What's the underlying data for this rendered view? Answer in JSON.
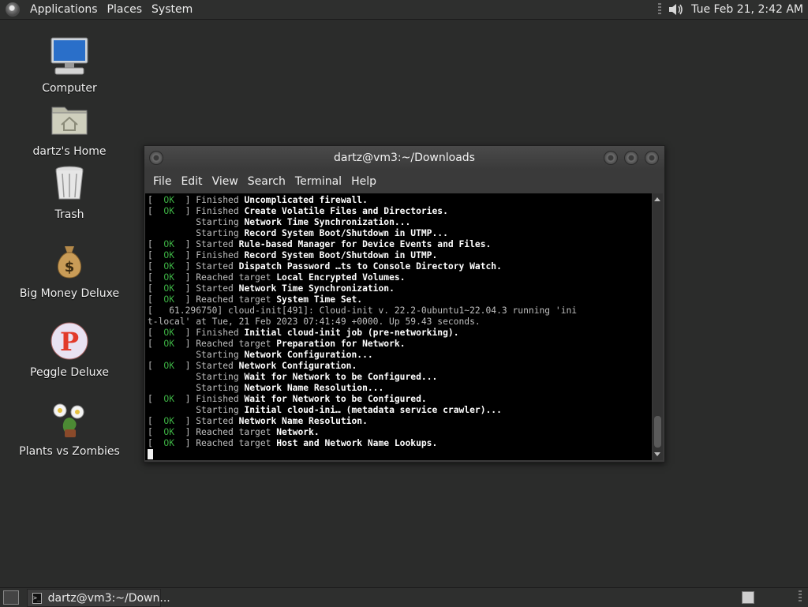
{
  "top_panel": {
    "menus": [
      "Applications",
      "Places",
      "System"
    ],
    "clock": "Tue Feb 21,  2:42 AM"
  },
  "desktop": {
    "icons": [
      {
        "label": "Computer",
        "icon": "computer-icon"
      },
      {
        "label": "dartz's Home",
        "icon": "home-folder-icon"
      },
      {
        "label": "Trash",
        "icon": "trash-icon"
      },
      {
        "label": "Big Money Deluxe",
        "icon": "money-bag-icon"
      },
      {
        "label": "Peggle Deluxe",
        "icon": "peggle-icon"
      },
      {
        "label": "Plants vs Zombies",
        "icon": "plants-vs-zombies-icon"
      }
    ]
  },
  "terminal": {
    "title": "dartz@vm3:~/Downloads",
    "menus": [
      "File",
      "Edit",
      "View",
      "Search",
      "Terminal",
      "Help"
    ],
    "lines": [
      {
        "prefix": "[  ",
        "ok": "OK",
        "suffix": "  ] Finished ",
        "bold": "Uncomplicated firewall",
        "tail": "."
      },
      {
        "prefix": "[  ",
        "ok": "OK",
        "suffix": "  ] Finished ",
        "bold": "Create Volatile Files and Directories",
        "tail": "."
      },
      {
        "prefix": "",
        "ok": "",
        "suffix": "         Starting ",
        "bold": "Network Time Synchronization",
        "tail": "..."
      },
      {
        "prefix": "",
        "ok": "",
        "suffix": "         Starting ",
        "bold": "Record System Boot/Shutdown in UTMP",
        "tail": "..."
      },
      {
        "prefix": "[  ",
        "ok": "OK",
        "suffix": "  ] Started ",
        "bold": "Rule-based Manager for Device Events and Files",
        "tail": "."
      },
      {
        "prefix": "[  ",
        "ok": "OK",
        "suffix": "  ] Finished ",
        "bold": "Record System Boot/Shutdown in UTMP",
        "tail": "."
      },
      {
        "prefix": "[  ",
        "ok": "OK",
        "suffix": "  ] Started ",
        "bold": "Dispatch Password …ts to Console Directory Watch",
        "tail": "."
      },
      {
        "prefix": "[  ",
        "ok": "OK",
        "suffix": "  ] Reached target ",
        "bold": "Local Encrypted Volumes",
        "tail": "."
      },
      {
        "prefix": "[  ",
        "ok": "OK",
        "suffix": "  ] Started ",
        "bold": "Network Time Synchronization",
        "tail": "."
      },
      {
        "prefix": "[  ",
        "ok": "OK",
        "suffix": "  ] Reached target ",
        "bold": "System Time Set",
        "tail": "."
      },
      {
        "prefix": "[   61.296750] cloud-init[491]: Cloud-init v. 22.2-0ubuntu1~22.04.3 running 'ini",
        "ok": "",
        "suffix": "",
        "bold": "",
        "tail": ""
      },
      {
        "prefix": "t-local' at Tue, 21 Feb 2023 07:41:49 +0000. Up 59.43 seconds.",
        "ok": "",
        "suffix": "",
        "bold": "",
        "tail": ""
      },
      {
        "prefix": "[  ",
        "ok": "OK",
        "suffix": "  ] Finished ",
        "bold": "Initial cloud-init job (pre-networking)",
        "tail": "."
      },
      {
        "prefix": "[  ",
        "ok": "OK",
        "suffix": "  ] Reached target ",
        "bold": "Preparation for Network",
        "tail": "."
      },
      {
        "prefix": "",
        "ok": "",
        "suffix": "         Starting ",
        "bold": "Network Configuration",
        "tail": "..."
      },
      {
        "prefix": "[  ",
        "ok": "OK",
        "suffix": "  ] Started ",
        "bold": "Network Configuration",
        "tail": "."
      },
      {
        "prefix": "",
        "ok": "",
        "suffix": "         Starting ",
        "bold": "Wait for Network to be Configured",
        "tail": "..."
      },
      {
        "prefix": "",
        "ok": "",
        "suffix": "         Starting ",
        "bold": "Network Name Resolution",
        "tail": "..."
      },
      {
        "prefix": "[  ",
        "ok": "OK",
        "suffix": "  ] Finished ",
        "bold": "Wait for Network to be Configured",
        "tail": "."
      },
      {
        "prefix": "",
        "ok": "",
        "suffix": "         Starting ",
        "bold": "Initial cloud-ini… (metadata service crawler)",
        "tail": "..."
      },
      {
        "prefix": "[  ",
        "ok": "OK",
        "suffix": "  ] Started ",
        "bold": "Network Name Resolution",
        "tail": "."
      },
      {
        "prefix": "[  ",
        "ok": "OK",
        "suffix": "  ] Reached target ",
        "bold": "Network",
        "tail": "."
      },
      {
        "prefix": "[  ",
        "ok": "OK",
        "suffix": "  ] Reached target ",
        "bold": "Host and Network Name Lookups",
        "tail": "."
      }
    ]
  },
  "bottom_panel": {
    "task_label": "dartz@vm3:~/Down...",
    "task_icon_text": ">_"
  },
  "colors": {
    "ok_green": "#3cb043",
    "terminal_bg": "#000000",
    "desktop_bg": "#2b2c2b"
  }
}
